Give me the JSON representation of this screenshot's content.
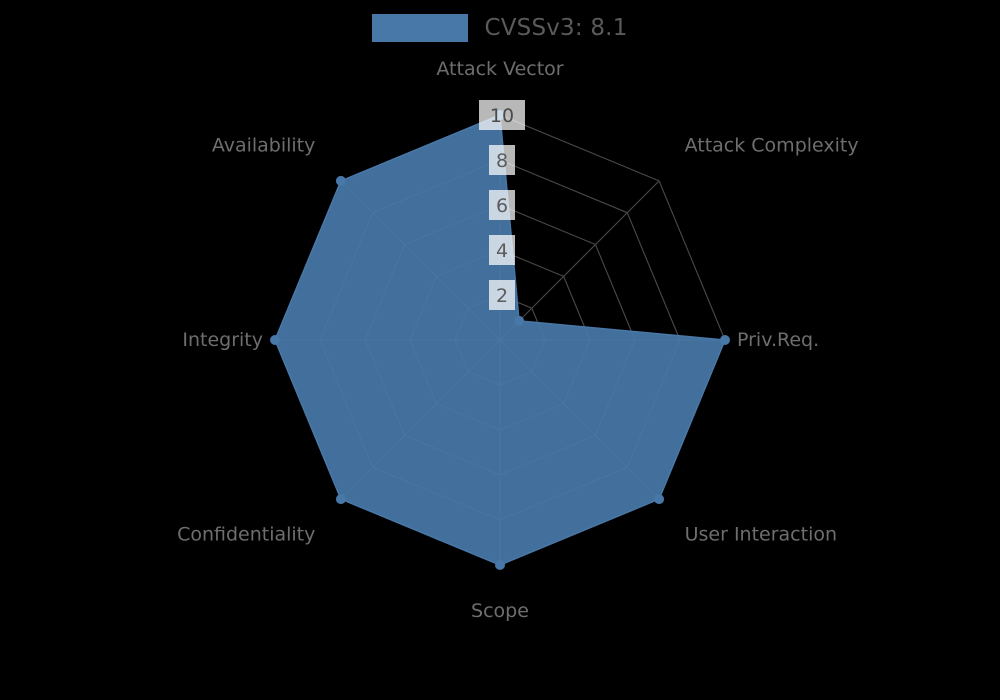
{
  "legend": {
    "label": "CVSSv3: 8.1",
    "swatch_color": "#4878a8",
    "position": "top-center"
  },
  "chart_data": {
    "type": "radar",
    "title": "",
    "subtitle": "",
    "xlabel": "",
    "ylabel": "",
    "grid": true,
    "legend_position": "top-center",
    "rlim": [
      0,
      10
    ],
    "r_ticks": [
      "2",
      "4",
      "6",
      "8",
      "10"
    ],
    "r_tick_values": [
      2,
      4,
      6,
      8,
      10
    ],
    "categories": [
      "Attack Vector",
      "Attack Complexity",
      "Priv.Req.",
      "User Interaction",
      "Scope",
      "Confidentiality",
      "Integrity",
      "Availability"
    ],
    "series": [
      {
        "name": "CVSSv3: 8.1",
        "color": "#4878a8",
        "values": [
          10,
          1.2,
          10,
          10,
          10,
          10,
          10,
          10
        ]
      }
    ]
  },
  "axis_labels": {
    "attack_vector": "Attack Vector",
    "attack_complexity": "Attack Complexity",
    "priv_req": "Priv.Req.",
    "user_interaction": "User Interaction",
    "scope": "Scope",
    "confidentiality": "Confidentiality",
    "integrity": "Integrity",
    "availability": "Availability"
  },
  "colors": {
    "background": "#000000",
    "series": "#4878a8",
    "grid": "#4a4a4a",
    "label_text": "#6e6e6e",
    "tick_text": "#5c5c5c"
  }
}
